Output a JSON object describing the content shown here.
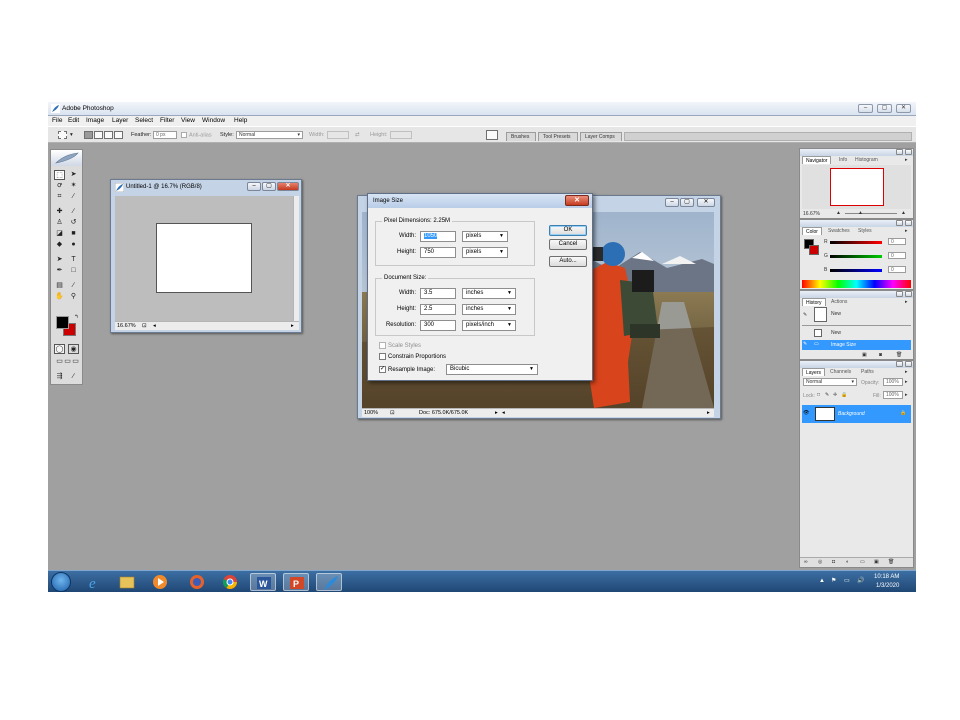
{
  "app": {
    "title": "Adobe Photoshop",
    "window_buttons": {
      "minimize": "–",
      "maximize": "▢",
      "close": "✕"
    }
  },
  "menu": [
    "File",
    "Edit",
    "Image",
    "Layer",
    "Select",
    "Filter",
    "View",
    "Window",
    "Help"
  ],
  "options_bar": {
    "feather_label": "Feather:",
    "feather_value": "0 px",
    "antialias_label": "Anti-alias",
    "style_label": "Style:",
    "style_value": "Normal",
    "width_label": "Width:",
    "height_label": "Height:",
    "well_tabs": [
      "Brushes",
      "Tool Presets",
      "Layer Comps"
    ]
  },
  "untitled_doc": {
    "title": "Untitled-1 @ 16.7% (RGB/8)",
    "zoom": "16.67%"
  },
  "photo_doc": {
    "zoom": "100%",
    "doc_info": "Doc: 675.0K/675.0K"
  },
  "image_size_dialog": {
    "title": "Image Size",
    "close": "✕",
    "pixel_dimensions_label": "Pixel Dimensions:",
    "pixel_dimensions_value": "2.25M",
    "pixel_width_label": "Width:",
    "pixel_width_value": "1050",
    "pixel_width_unit": "pixels",
    "pixel_height_label": "Height:",
    "pixel_height_value": "750",
    "pixel_height_unit": "pixels",
    "document_size_label": "Document Size:",
    "doc_width_label": "Width:",
    "doc_width_value": "3.5",
    "doc_width_unit": "inches",
    "doc_height_label": "Height:",
    "doc_height_value": "2.5",
    "doc_height_unit": "inches",
    "resolution_label": "Resolution:",
    "resolution_value": "300",
    "resolution_unit": "pixels/inch",
    "scale_styles_label": "Scale Styles",
    "scale_styles_checked": false,
    "constrain_label": "Constrain Proportions",
    "constrain_checked": false,
    "resample_label": "Resample Image:",
    "resample_checked": true,
    "resample_value": "Bicubic",
    "ok_label": "OK",
    "cancel_label": "Cancel",
    "auto_label": "Auto..."
  },
  "navigator_panel": {
    "tabs": [
      "Navigator",
      "Info",
      "Histogram"
    ],
    "zoom": "16.67%"
  },
  "color_panel": {
    "tabs": [
      "Color",
      "Swatches",
      "Styles"
    ],
    "r_label": "R",
    "g_label": "G",
    "b_label": "B",
    "r_value": "0",
    "g_value": "0",
    "b_value": "0"
  },
  "history_panel": {
    "tabs": [
      "History",
      "Actions"
    ],
    "snapshot_label": "New",
    "items": [
      "New",
      "Image Size"
    ]
  },
  "layers_panel": {
    "tabs": [
      "Layers",
      "Channels",
      "Paths"
    ],
    "blend_mode": "Normal",
    "opacity_label": "Opacity:",
    "opacity_value": "100%",
    "lock_label": "Lock:",
    "fill_label": "Fill:",
    "fill_value": "100%",
    "layer_name": "Background"
  },
  "taskbar": {
    "time": "10:18 AM",
    "date": "1/3/2020"
  },
  "colors": {
    "workspace": "#a0a0a0",
    "selection_blue": "#3399ff",
    "foreground": "#000000",
    "background_swatch": "#cc0000"
  }
}
